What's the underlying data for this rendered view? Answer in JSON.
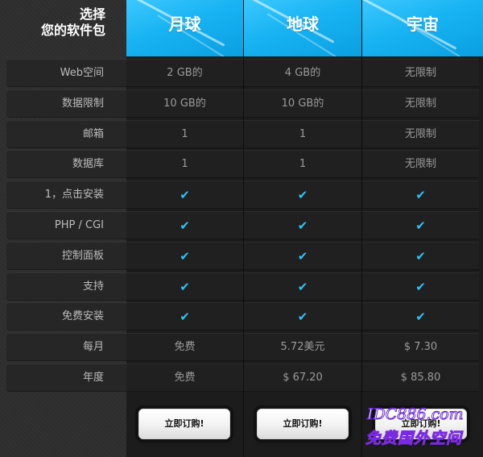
{
  "header": {
    "choose_line1": "选择",
    "choose_line2": "您的软件包",
    "plans": [
      "月球",
      "地球",
      "宇宙"
    ]
  },
  "rows": [
    {
      "label": "Web空间",
      "values": [
        "2 GB的",
        "4 GB的",
        "无限制"
      ]
    },
    {
      "label": "数据限制",
      "values": [
        "10 GB的",
        "10 GB的",
        "无限制"
      ]
    },
    {
      "label": "邮箱",
      "values": [
        "1",
        "1",
        "无限制"
      ]
    },
    {
      "label": "数据库",
      "values": [
        "1",
        "1",
        "无限制"
      ]
    },
    {
      "label": "1，点击安装",
      "values": [
        "✔",
        "✔",
        "✔"
      ]
    },
    {
      "label": "PHP / CGI",
      "values": [
        "✔",
        "✔",
        "✔"
      ]
    },
    {
      "label": "控制面板",
      "values": [
        "✔",
        "✔",
        "✔"
      ]
    },
    {
      "label": "支持",
      "values": [
        "✔",
        "✔",
        "✔"
      ]
    },
    {
      "label": "免费安装",
      "values": [
        "✔",
        "✔",
        "✔"
      ]
    },
    {
      "label": "每月",
      "values": [
        "免费",
        "5.72美元",
        "$ 7.30"
      ]
    },
    {
      "label": "年度",
      "values": [
        "免费",
        "$ 67.20",
        "$ 85.80"
      ]
    }
  ],
  "buttons": {
    "order_label": "立即订购!"
  },
  "watermark": {
    "line1": "IDC886.com",
    "line2": "免费国外空间"
  },
  "colors": {
    "accent_blue": "#17b3f2",
    "check": "#2ec3f4",
    "background": "#1c1c1c"
  }
}
